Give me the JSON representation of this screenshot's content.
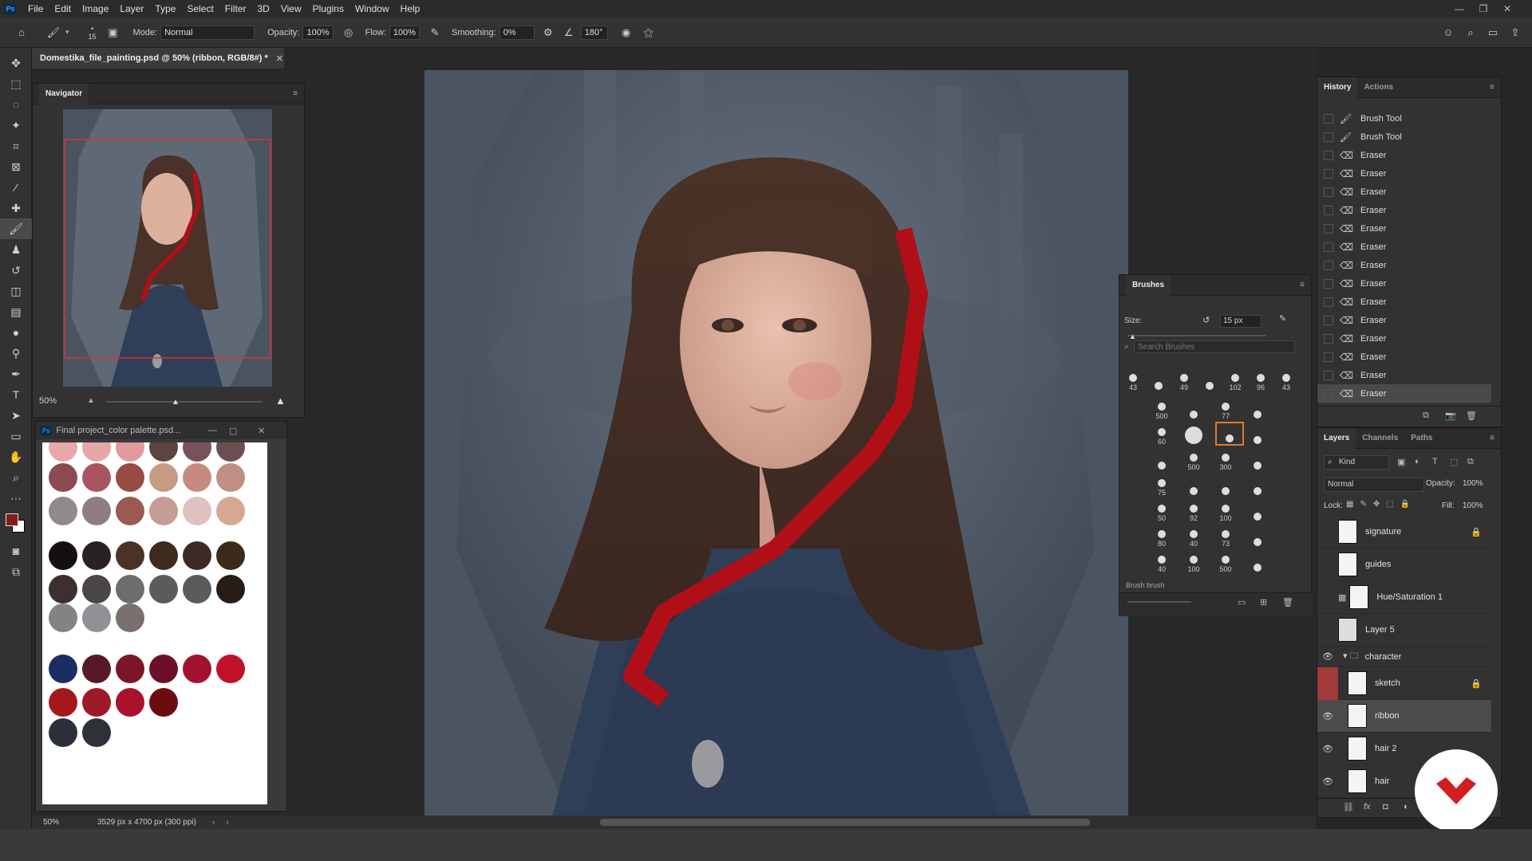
{
  "menubar": {
    "logo": "Ps",
    "items": [
      "File",
      "Edit",
      "Image",
      "Layer",
      "Type",
      "Select",
      "Filter",
      "3D",
      "View",
      "Plugins",
      "Window",
      "Help"
    ]
  },
  "options": {
    "brush_size": "15",
    "mode_label": "Mode:",
    "mode_value": "Normal",
    "opacity_label": "Opacity:",
    "opacity_value": "100%",
    "flow_label": "Flow:",
    "flow_value": "100%",
    "smoothing_label": "Smoothing:",
    "smoothing_value": "0%",
    "angle_value": "180°"
  },
  "document": {
    "tab_title": "Domestika_file_painting.psd @ 50% (ribbon, RGB/8#) *",
    "zoom": "50%",
    "dimensions": "3529 px x 4700 px (300 ppi)"
  },
  "navigator": {
    "title": "Navigator",
    "zoom": "50%"
  },
  "palette": {
    "title": "Final project_color palette.psd...",
    "colors": [
      [
        "#e9a8a9",
        "#e6a7a6",
        "#e2999c",
        "#5e4343",
        "#76525a",
        "#6b4e50"
      ],
      [
        "#8b4a52",
        "#a85561",
        "#984a45",
        "#c69a83",
        "#c68b7f",
        "#bf8f83"
      ],
      [
        "#928a8a",
        "#8d7e82",
        "#9a5a52",
        "#c59d94",
        "#dfc1c2",
        "#d6a793"
      ],
      [
        "#150f10",
        "#2a2222",
        "#4b3226",
        "#3f2a1e",
        "#3b2b24",
        "#3c2a1a"
      ],
      [
        "#3d2e2f",
        "#4b4646",
        "#6f6c6d",
        "#5d5a5d",
        "#595b5c",
        "#271c16"
      ],
      [
        "#838284",
        "#8f9196",
        "#77706f"
      ],
      [
        "#1b2d63",
        "#591825",
        "#7c1528",
        "#6c0f28",
        "#a31230",
        "#c1122a"
      ],
      [
        "#a3181c",
        "#9e1a28",
        "#a8122c",
        "#6c0c10"
      ],
      [
        "#2b2f3a",
        "#2f3138"
      ]
    ]
  },
  "brushes": {
    "title": "Brushes",
    "size_label": "Size:",
    "size_value": "15 px",
    "search_placeholder": "Search Brushes",
    "group_label": "Brush brush",
    "row1": [
      "43",
      "",
      "49",
      "",
      "102",
      "96",
      "43"
    ],
    "grid": [
      [
        "500",
        "",
        "77",
        ""
      ],
      [
        "60",
        "",
        "",
        ""
      ],
      [
        "",
        "500",
        "300",
        ""
      ],
      [
        "75",
        "",
        "",
        ""
      ],
      [
        "50",
        "92",
        "100",
        ""
      ],
      [
        "80",
        "40",
        "73",
        ""
      ],
      [
        "40",
        "100",
        "500",
        ""
      ]
    ]
  },
  "history": {
    "tabs": [
      "History",
      "Actions"
    ],
    "items": [
      "Brush Tool",
      "Brush Tool",
      "Eraser",
      "Eraser",
      "Eraser",
      "Eraser",
      "Eraser",
      "Eraser",
      "Eraser",
      "Eraser",
      "Eraser",
      "Eraser",
      "Eraser",
      "Eraser",
      "Eraser",
      "Eraser"
    ]
  },
  "layers": {
    "tabs": [
      "Layers",
      "Channels",
      "Paths"
    ],
    "kind_label": "Kind",
    "blend_mode": "Normal",
    "opacity_label": "Opacity:",
    "opacity_value": "100%",
    "lock_label": "Lock:",
    "fill_label": "Fill:",
    "fill_value": "100%",
    "items": [
      {
        "name": "signature",
        "visible": false,
        "locked": true
      },
      {
        "name": "guides",
        "visible": false,
        "locked": false
      },
      {
        "name": "Hue/Saturation 1",
        "visible": false,
        "locked": false
      },
      {
        "name": "Layer 5",
        "visible": false,
        "locked": false
      },
      {
        "name": "character",
        "visible": true,
        "locked": false
      },
      {
        "name": "sketch",
        "visible": false,
        "locked": true
      },
      {
        "name": "ribbon",
        "visible": true,
        "locked": false
      },
      {
        "name": "hair 2",
        "visible": true,
        "locked": false
      },
      {
        "name": "hair",
        "visible": true,
        "locked": false
      }
    ]
  },
  "colors": {
    "foreground": "#8a1a1a",
    "background": "#ffffff",
    "accent_red": "#d21e1e"
  }
}
